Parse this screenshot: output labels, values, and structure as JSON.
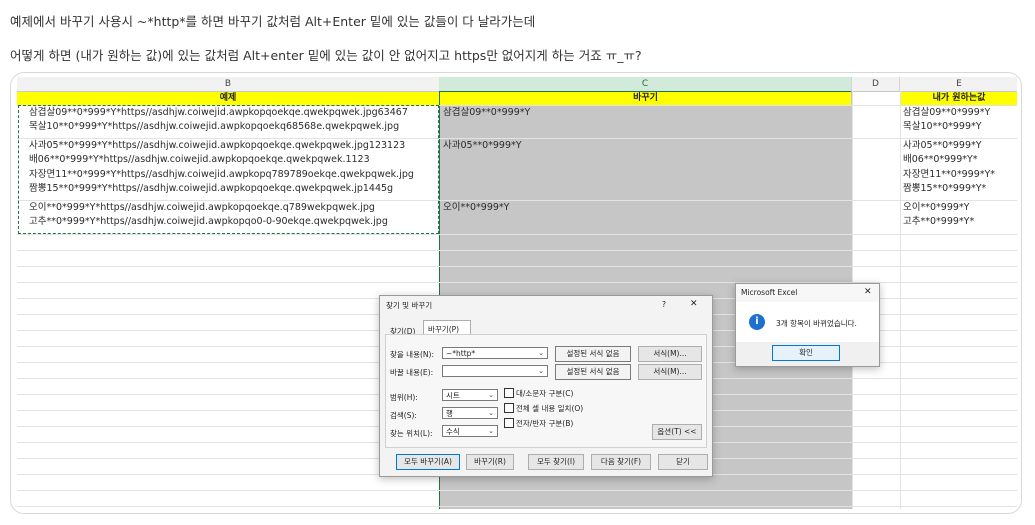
{
  "post": {
    "line1": "예제에서 바꾸기 사용시 ~*http*를 하면 바꾸기 값처럼 Alt+Enter 밑에 있는 값들이 다 날라가는데",
    "line2": "어떻게 하면 (내가 원하는 값)에 있는 값처럼 Alt+enter 밑에 있는 값이 안 없어지고 https만 없어지게 하는 거죠 ㅠ_ㅠ?"
  },
  "sheet": {
    "columns": [
      "B",
      "C",
      "D",
      "E"
    ],
    "headers": {
      "b": "예제",
      "c": "바꾸기",
      "e": "내가 원하는값"
    },
    "b_cells": [
      [
        "삼겹살09**0*999*Y*https//asdhjw.coiwejid.awpkopqoekqe.qwekpqwek.jpg63467",
        "목살10**0*999*Y*https//asdhjw.coiwejid.awpkopqoekq68568e.qwekpqwek.jpg"
      ],
      [
        "사과05**0*999*Y*https//asdhjw.coiwejid.awpkopqoekqe.qwekpqwek.jpg123123",
        "배06**0*999*Y*https//asdhjw.coiwejid.awpkopqoekqe.qwekpqwek.1123",
        "자장면11**0*999*Y*https//asdhjw.coiwejid.awpkopq789789oekqe.qwekpqwek.jpg",
        "짬뽕15**0*999*Y*https//asdhjw.coiwejid.awpkopqoekqe.qwekpqwek.jp1445g"
      ],
      [
        "오이**0*999*Y*https//asdhjw.coiwejid.awpkopqoekqe.q789wekpqwek.jpg",
        "고추**0*999*Y*https//asdhjw.coiwejid.awpkopqo0-0-90ekqe.qwekpqwek.jpg"
      ]
    ],
    "c_cells": [
      "삼겹살09**0*999*Y",
      "사과05**0*999*Y",
      "오이**0*999*Y"
    ],
    "e_cells": [
      [
        "삼겹살09**0*999*Y",
        "목살10**0*999*Y"
      ],
      [
        "사과05**0*999*Y",
        "배06**0*999*Y*",
        "자장면11**0*999*Y*",
        "짬뽕15**0*999*Y*"
      ],
      [
        "오이**0*999*Y",
        "고추**0*999*Y*"
      ]
    ]
  },
  "find_replace": {
    "title": "찾기 및 바꾸기",
    "help": "?",
    "close": "✕",
    "tab_find": "찾기(D)",
    "tab_replace": "바꾸기(P)",
    "find_label": "찾을 내용(N):",
    "find_value": "~*http*",
    "replace_label": "바꿀 내용(E):",
    "replace_value": "",
    "no_format_1": "설정된 서식 없음",
    "no_format_2": "설정된 서식 없음",
    "format_1": "서식(M)...",
    "format_2": "서식(M)...",
    "scope_label": "범위(H):",
    "scope_value": "시트",
    "search_label": "검색(S):",
    "search_value": "행",
    "look_in_label": "찾는 위치(L):",
    "look_in_value": "수식",
    "opt_case": "대/소문자 구분(C)",
    "opt_whole": "전체 셀 내용 일치(O)",
    "opt_width": "전자/반자 구분(B)",
    "options_btn": "옵션(T) <<",
    "replace_all": "모두 바꾸기(A)",
    "replace": "바꾸기(R)",
    "find_all": "모두 찾기(I)",
    "find_next": "다음 찾기(F)",
    "close_btn": "닫기"
  },
  "msgbox": {
    "title": "Microsoft Excel",
    "close": "✕",
    "icon_glyph": "i",
    "message": "3개 항목이 바뀌었습니다.",
    "ok": "확인"
  },
  "colors": {
    "excel_green": "#217346",
    "header_yellow": "#ffff00",
    "selection_gray": "#c6c6c6",
    "info_blue": "#1d6fd1"
  }
}
